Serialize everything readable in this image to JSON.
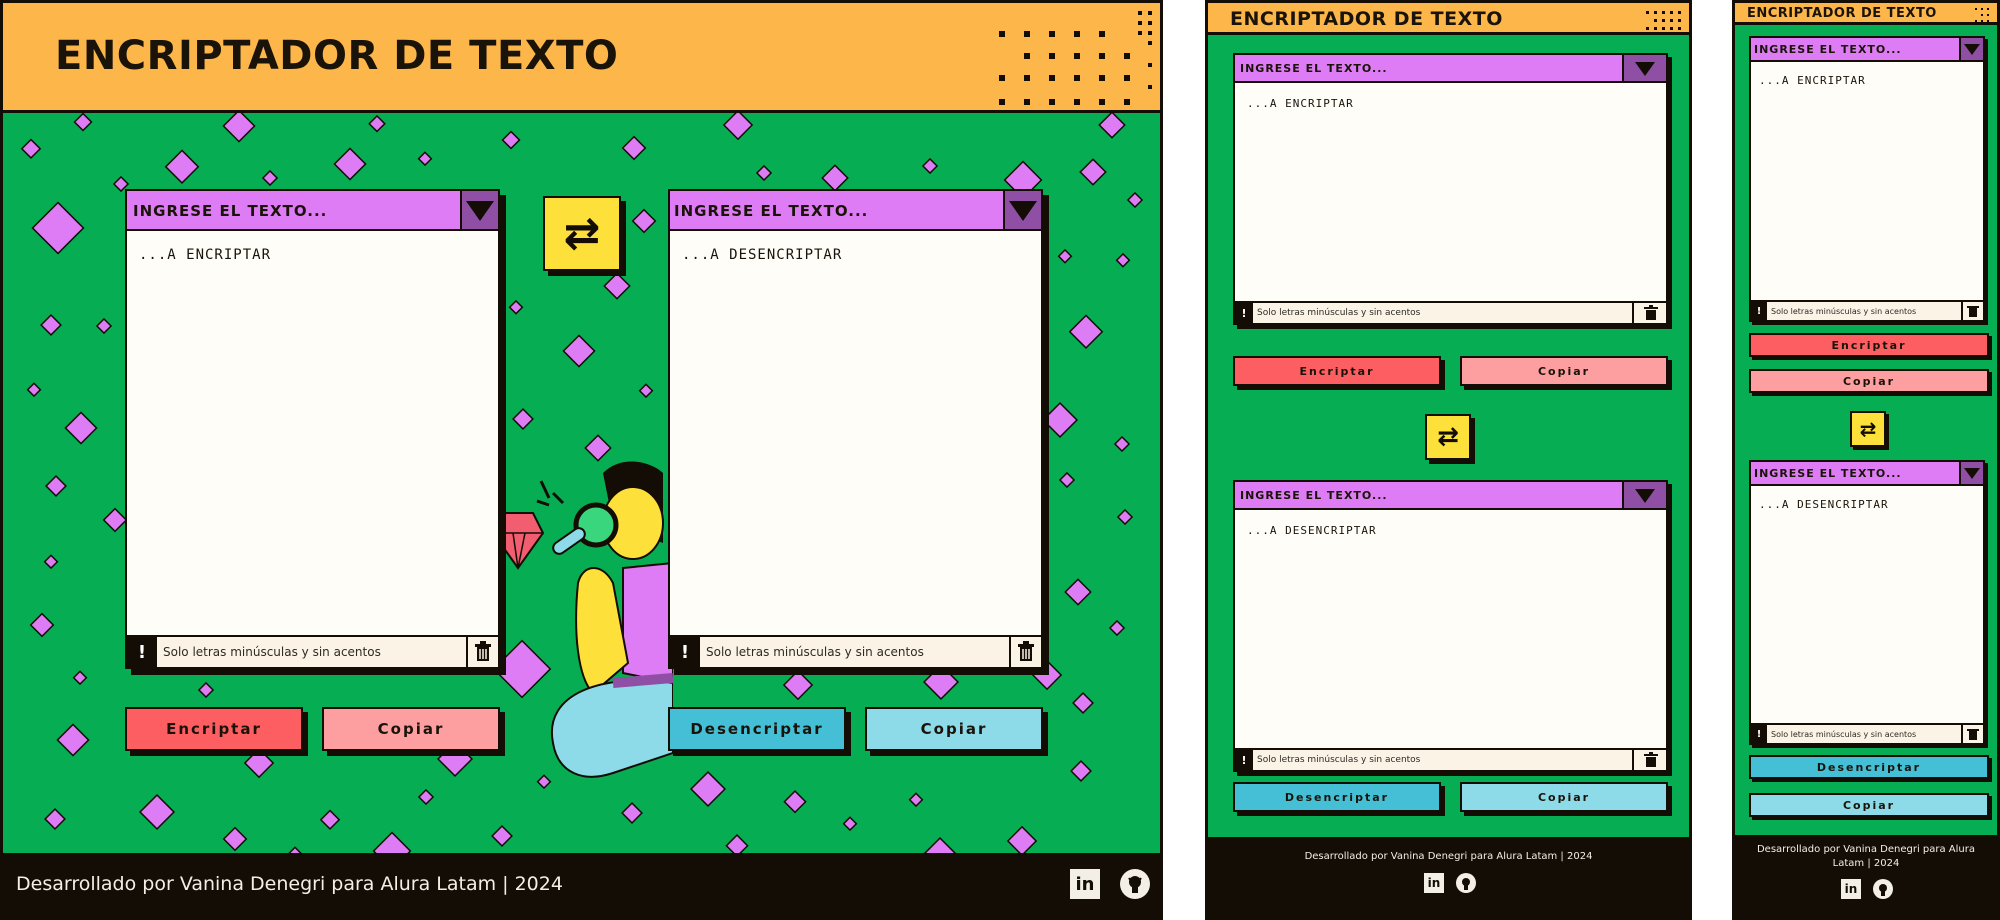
{
  "title": "ENCRIPTADOR DE TEXTO",
  "input_card": {
    "title": "INGRESE EL TEXTO...",
    "placeholder": "...A ENCRIPTAR",
    "note": "Solo letras minúsculas y sin acentos",
    "warning_symbol": "!"
  },
  "output_card": {
    "title": "INGRESE EL TEXTO...",
    "placeholder": "...A DESENCRIPTAR",
    "note": "Solo letras minúsculas y sin acentos",
    "warning_symbol": "!"
  },
  "buttons": {
    "encrypt": "Encriptar",
    "copy_input": "Copiar",
    "decrypt": "Desencriptar",
    "copy_output": "Copiar"
  },
  "swap_icon": "⇄",
  "footer": {
    "text": "Desarrollado por Vanina Denegri para Alura Latam | 2024",
    "social": [
      {
        "name": "linkedin-icon",
        "label": "in"
      },
      {
        "name": "github-icon",
        "label": "gh"
      }
    ]
  },
  "colors": {
    "background": "#07ad52",
    "header": "#fdb64a",
    "card_bar": "#dd7cf4",
    "encrypt": "#fc5e62",
    "copy_input": "#fd9ea0",
    "decrypt": "#45bfd6",
    "copy_output": "#8ddbe9",
    "swap": "#fde13a",
    "footer": "#140d05"
  }
}
